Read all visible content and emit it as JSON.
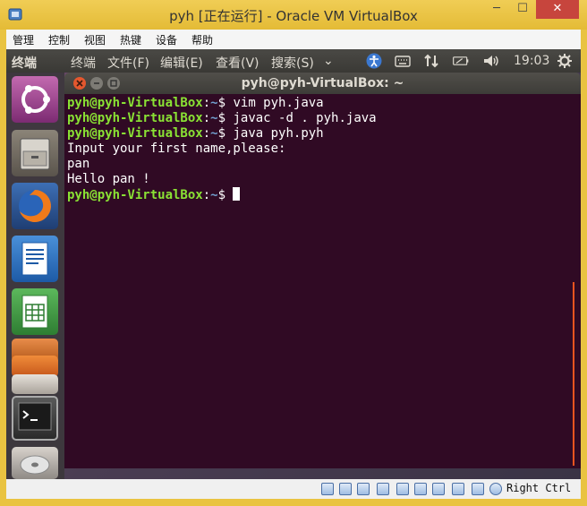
{
  "host": {
    "title": "pyh [正在运行] - Oracle VM VirtualBox",
    "window_buttons": {
      "minimize": "─",
      "maximize": "☐",
      "close": "✕"
    },
    "menu": [
      "管理",
      "控制",
      "视图",
      "热键",
      "设备",
      "帮助"
    ]
  },
  "guest_panel": {
    "app_name": "终端",
    "menus": [
      "终端",
      "文件(F)",
      "编辑(E)",
      "查看(V)",
      "搜索(S)"
    ],
    "overflow": "⌄",
    "clock": "19:03",
    "indicators": [
      "accessibility-icon",
      "keyboard-icon",
      "network-icon",
      "battery-icon",
      "volume-icon",
      "gear-icon"
    ]
  },
  "launcher": {
    "items": [
      "dash-icon",
      "files-icon",
      "firefox-icon",
      "writer-icon",
      "calc-icon",
      "impress-icon",
      "software-center-icon",
      "amazon-icon",
      "terminal-icon",
      "dvd-icon"
    ]
  },
  "terminal": {
    "title": "pyh@pyh-VirtualBox: ~",
    "prompt_user": "pyh@pyh-VirtualBox",
    "prompt_path": "~",
    "prompt_symbol": "$",
    "commands": [
      "vim pyh.java",
      "javac -d . pyh.java",
      "java pyh.pyh"
    ],
    "output": [
      "Input your first name,please:",
      "pan",
      "Hello pan !"
    ]
  },
  "statusbar": {
    "host_key": "Right Ctrl"
  },
  "colors": {
    "terminal_bg": "#300a24",
    "prompt_user": "#8ae234",
    "prompt_path": "#729fcf",
    "host_frame": "#e9c341",
    "ubuntu_orange": "#e95420"
  }
}
